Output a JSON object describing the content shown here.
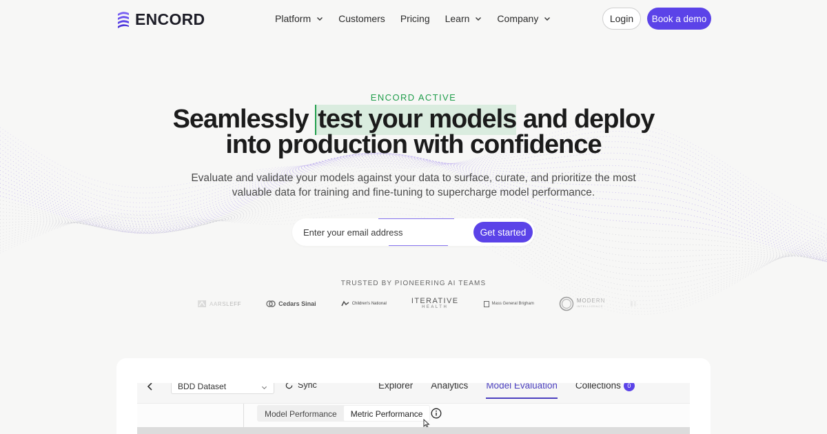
{
  "brand": {
    "name": "ENCORD",
    "accent": "#5b43e8",
    "eyebrow_color": "#1f9d4a"
  },
  "nav": {
    "items": [
      {
        "label": "Platform",
        "has_dropdown": true
      },
      {
        "label": "Customers",
        "has_dropdown": false
      },
      {
        "label": "Pricing",
        "has_dropdown": false
      },
      {
        "label": "Learn",
        "has_dropdown": true
      },
      {
        "label": "Company",
        "has_dropdown": true
      }
    ],
    "login_label": "Login",
    "demo_label": "Book a demo"
  },
  "hero": {
    "eyebrow": "ENCORD ACTIVE",
    "headline_pre": "Seamlessly ",
    "headline_highlight": "test your models",
    "headline_post": " and deploy",
    "headline_line2": "into production with confidence",
    "subtitle": "Evaluate and validate your models against your data to surface, curate, and prioritize the most valuable data for training and fine-tuning to supercharge model performance.",
    "email_placeholder": "Enter your email address",
    "cta_label": "Get started"
  },
  "trusted": {
    "heading": "TRUSTED BY PIONEERING AI TEAMS",
    "logos": [
      {
        "name": "AARSLEFF",
        "icon": "aarsleff-logo"
      },
      {
        "name": "Cedars Sinai",
        "icon": "cedars-sinai-logo"
      },
      {
        "name": "Children's National",
        "icon": "childrens-national-logo"
      },
      {
        "name": "ITERATIVE",
        "sub": "HEALTH",
        "icon": "iterative-health-logo"
      },
      {
        "name": "Mass General Brigham",
        "icon": "mass-general-brigham-logo"
      },
      {
        "name": "MODERN",
        "sub": "INTELLIGENCE",
        "icon": "modern-intelligence-logo"
      },
      {
        "name": "Pr",
        "icon": "partial-logo"
      }
    ]
  },
  "app_preview": {
    "dataset": "BDD Dataset",
    "sync_label": "Sync",
    "tabs": [
      {
        "label": "Explorer",
        "active": false
      },
      {
        "label": "Analytics",
        "active": false
      },
      {
        "label": "Model Evaluation",
        "active": true
      },
      {
        "label": "Collections",
        "active": false,
        "badge": "0"
      }
    ],
    "subtabs": [
      {
        "label": "Model Performance",
        "active": false
      },
      {
        "label": "Metric Performance",
        "active": true
      }
    ]
  }
}
